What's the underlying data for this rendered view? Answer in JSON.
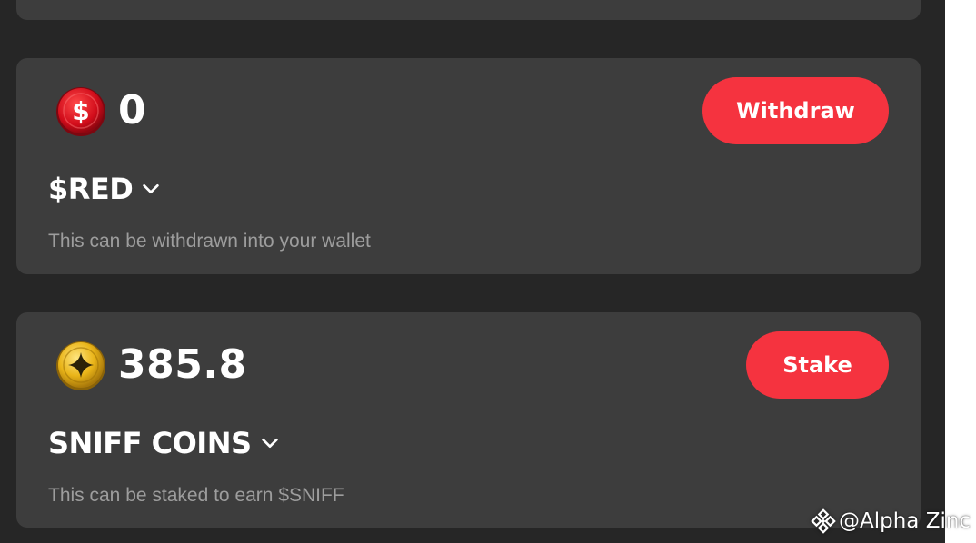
{
  "wallets": [
    {
      "coin_icon": "red-dollar-coin-icon",
      "amount": "0",
      "token": "$RED",
      "description": "This can be withdrawn into your wallet",
      "action_label": "Withdraw"
    },
    {
      "coin_icon": "gold-sniff-coin-icon",
      "amount": "385.8",
      "token": "SNIFF COINS",
      "description": "This can be staked to earn $SNIFF",
      "action_label": "Stake"
    }
  ],
  "watermark": {
    "icon": "binance-logo-icon",
    "text": "@Alpha Zinc"
  },
  "colors": {
    "background": "#262626",
    "card": "#3d3d3d",
    "accent": "#f5333f",
    "muted_text": "#9d9d9d"
  }
}
